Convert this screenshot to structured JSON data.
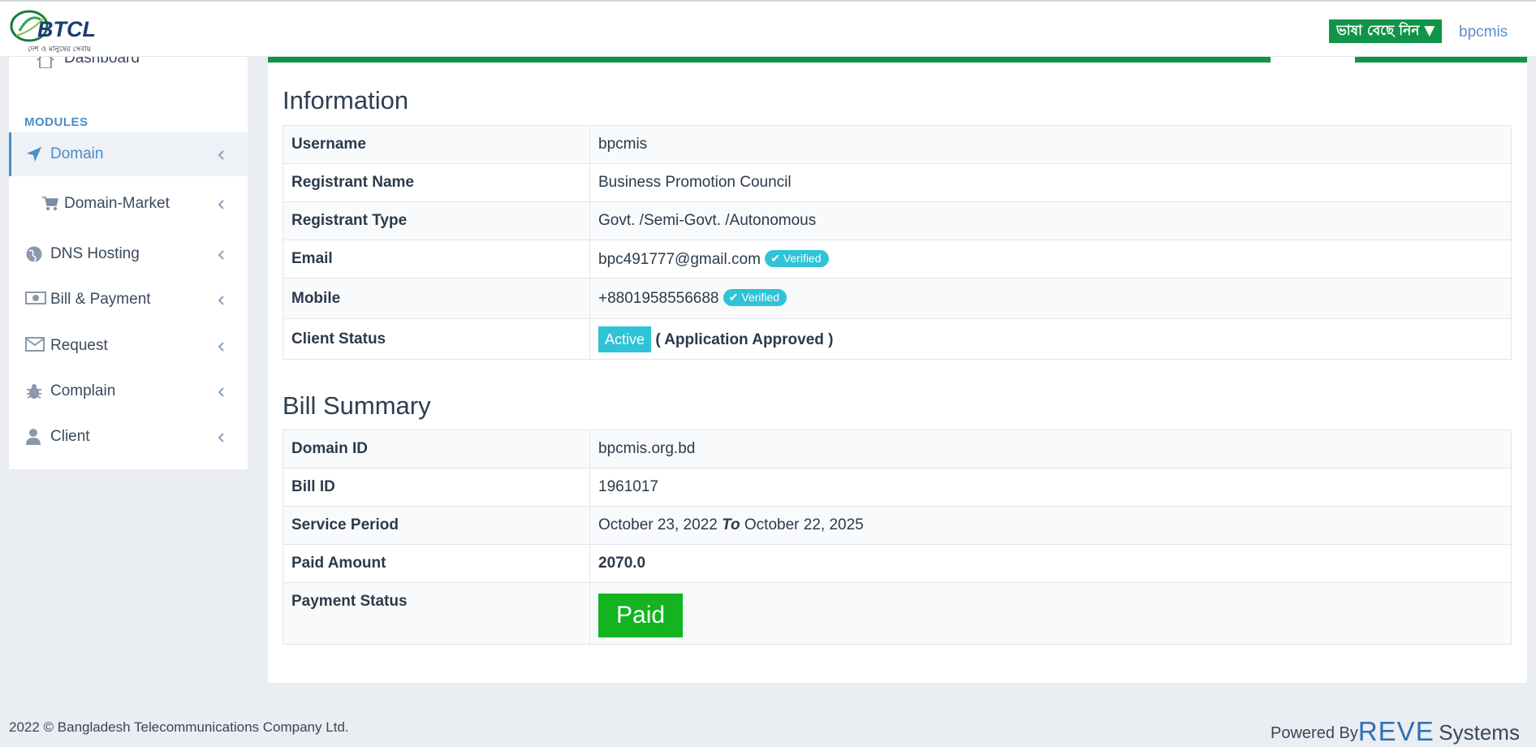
{
  "header": {
    "logo_text": "BTCL",
    "logo_tagline": "দেশ ও মানুষের সেবায়",
    "language_button": "ভাষা বেছে নিন ▼",
    "user_link": "bpcmis"
  },
  "sidebar": {
    "dashboard_label": "Dashboard",
    "modules_title": "MODULES",
    "items": [
      {
        "label": "Domain",
        "icon": "location-arrow-icon",
        "active": true
      },
      {
        "label": "Domain-Market",
        "icon": "shopping-cart-icon",
        "sub": true
      },
      {
        "label": "DNS Hosting",
        "icon": "globe-icon"
      },
      {
        "label": "Bill & Payment",
        "icon": "money-bill-icon"
      },
      {
        "label": "Request",
        "icon": "envelope-icon"
      },
      {
        "label": "Complain",
        "icon": "bug-icon"
      },
      {
        "label": "Client",
        "icon": "user-icon"
      }
    ]
  },
  "information": {
    "title": "Information",
    "rows": {
      "username_label": "Username",
      "username_value": "bpcmis",
      "registrant_name_label": "Registrant Name",
      "registrant_name_value": "Business Promotion Council",
      "registrant_type_label": "Registrant Type",
      "registrant_type_value": "Govt. /Semi-Govt. /Autonomous",
      "email_label": "Email",
      "email_value": "bpc491777@gmail.com",
      "email_badge": "Verified",
      "mobile_label": "Mobile",
      "mobile_value": "+8801958556688",
      "mobile_badge": "Verified",
      "client_status_label": "Client Status",
      "client_status_value": "Active",
      "client_status_note": "( Application Approved )"
    }
  },
  "bill_summary": {
    "title": "Bill Summary",
    "rows": {
      "domain_id_label": "Domain ID",
      "domain_id_value": "bpcmis.org.bd",
      "bill_id_label": "Bill ID",
      "bill_id_value": "1961017",
      "service_period_label": "Service Period",
      "service_period_start": "October 23, 2022",
      "service_period_to": "To",
      "service_period_end": "October 22, 2025",
      "paid_amount_label": "Paid Amount",
      "paid_amount_value": "2070.0",
      "payment_status_label": "Payment Status",
      "payment_status_value": "Paid"
    }
  },
  "footer": {
    "copyright": "2022 © Bangladesh Telecommunications Company Ltd.",
    "powered_by": "Powered By",
    "reve": "REVE",
    "systems": "Systems"
  },
  "colors": {
    "brand_green": "#109447",
    "accent_blue": "#4a8ec7",
    "badge_cyan": "#2ec3d6",
    "paid_green": "#13b41f"
  }
}
